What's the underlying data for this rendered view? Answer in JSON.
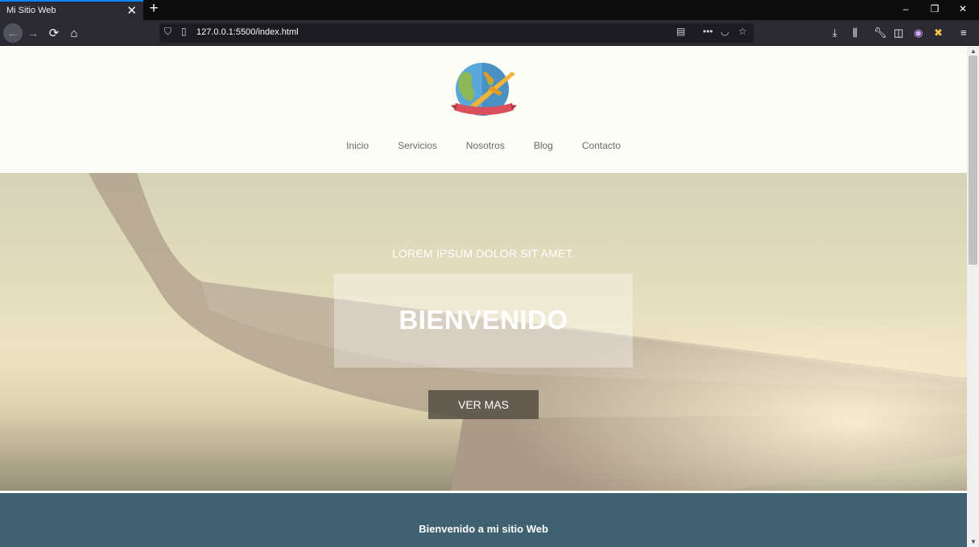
{
  "browser": {
    "tab_title": "Mi Sitio Web",
    "tab_close": "✕",
    "new_tab": "+",
    "url": "127.0.0.1:5500/index.html",
    "window_controls": [
      "–",
      "❐",
      "✕"
    ]
  },
  "site": {
    "nav": [
      "Inicio",
      "Servicios",
      "Nosotros",
      "Blog",
      "Contacto"
    ],
    "hero": {
      "eyebrow": "LOREM IPSUM DOLOR SIT AMET.",
      "title": "BIENVENIDO",
      "button": "VER MAS"
    },
    "welcome_title": "Bienvenido a mi sitio Web"
  },
  "colors": {
    "welcome_bg": "#3f606f",
    "button_bg": "#504b41",
    "accent_tab": "#0a84ff"
  },
  "icons": {
    "browser_toolbar": [
      "back-icon",
      "forward-icon",
      "reload-icon",
      "home-icon",
      "shield-icon",
      "page-icon",
      "reader-view-icon",
      "more-icon",
      "pocket-icon",
      "bookmark-star-icon",
      "download-icon",
      "library-icon",
      "wrench-icon",
      "sidebar-icon",
      "account-icon",
      "extension-icon",
      "menu-icon"
    ],
    "logo": "globe-airplane-logo"
  }
}
